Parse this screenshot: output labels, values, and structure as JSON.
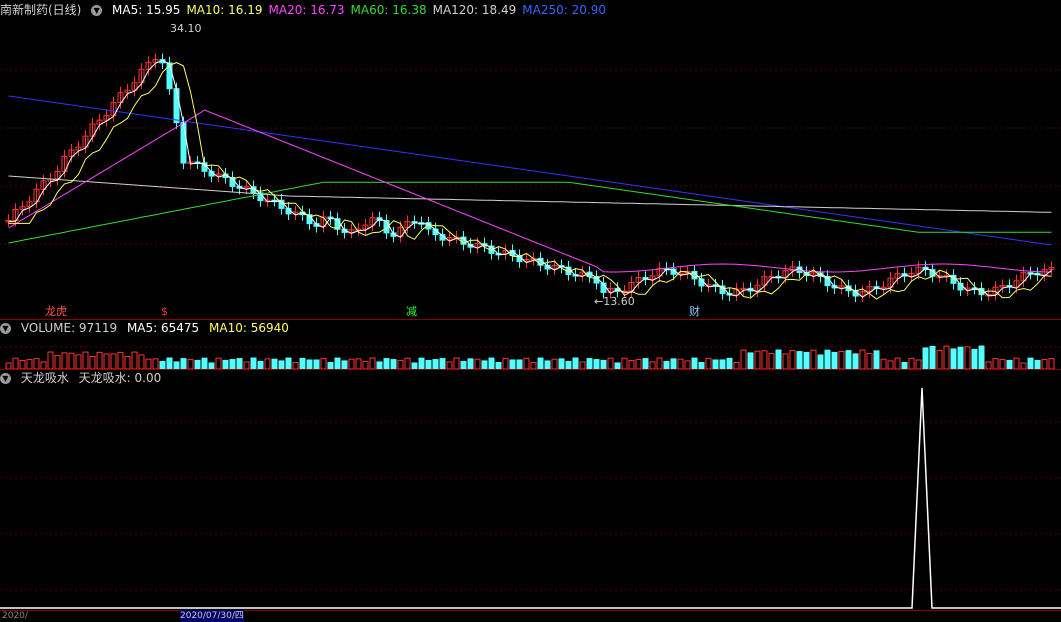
{
  "main": {
    "stock_title": "南新制药(日线)",
    "ma_items": [
      {
        "label": "MA5: 15.95",
        "color": "#ffffff"
      },
      {
        "label": "MA10: 16.19",
        "color": "#ffff66"
      },
      {
        "label": "MA20: 16.73",
        "color": "#ff44ff"
      },
      {
        "label": "MA60: 16.38",
        "color": "#33dd33"
      },
      {
        "label": "MA120: 18.49",
        "color": "#d0d0d0"
      },
      {
        "label": "MA250: 20.90",
        "color": "#3366ff"
      }
    ],
    "high_label": "34.10",
    "low_label": "←13.60",
    "badges": [
      {
        "text": "龙虎",
        "color": "#ff5555"
      },
      {
        "text": "$",
        "color": "#ff3333"
      },
      {
        "text": "减",
        "color": "#33ff33"
      },
      {
        "text": "财",
        "color": "#88ccff"
      }
    ]
  },
  "volume": {
    "title": "VOLUME: 97119",
    "ma5": "MA5: 65475",
    "ma10": "MA10: 56940"
  },
  "indicator": {
    "title": "天龙吸水",
    "value": "天龙吸水: 0.00"
  },
  "axis": {
    "labels": [
      "2020/",
      "2020/07/30/四"
    ]
  },
  "colors": {
    "up": "#ff3333",
    "down": "#54ffff",
    "grid": "#5a0000",
    "separator": "#8b0000"
  }
}
